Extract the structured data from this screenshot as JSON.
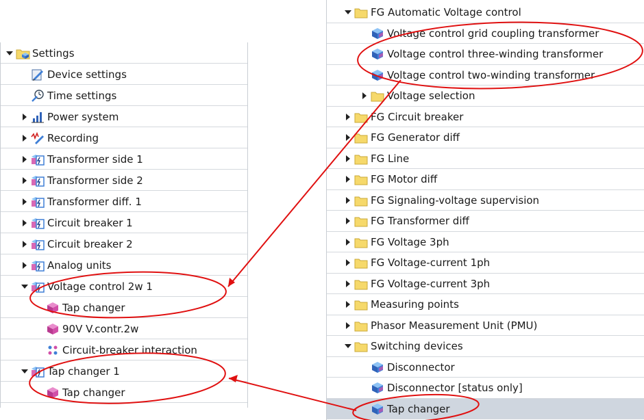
{
  "colors": {
    "annotation": "#e01010",
    "folder": "#f6d96b",
    "cube_blue": "#3f7fd6",
    "cube_pink": "#d14fa8",
    "row_selected": "#cfd6df"
  },
  "left_tree": {
    "items": [
      {
        "label": "Settings",
        "icon": "settings-folder-icon",
        "state": "expanded"
      },
      {
        "label": "Device settings",
        "icon": "device-settings-icon",
        "state": "leaf"
      },
      {
        "label": "Time settings",
        "icon": "time-settings-icon",
        "state": "leaf"
      },
      {
        "label": "Power system",
        "icon": "power-system-icon",
        "state": "collapsed"
      },
      {
        "label": "Recording",
        "icon": "recording-icon",
        "state": "collapsed"
      },
      {
        "label": "Transformer side 1",
        "icon": "function-group-icon",
        "state": "collapsed"
      },
      {
        "label": "Transformer side 2",
        "icon": "function-group-icon",
        "state": "collapsed"
      },
      {
        "label": "Transformer diff. 1",
        "icon": "function-group-icon",
        "state": "collapsed"
      },
      {
        "label": "Circuit breaker 1",
        "icon": "function-group-icon",
        "state": "collapsed"
      },
      {
        "label": "Circuit breaker 2",
        "icon": "function-group-icon",
        "state": "collapsed"
      },
      {
        "label": "Analog units",
        "icon": "function-group-icon",
        "state": "collapsed"
      },
      {
        "label": "Voltage control 2w 1",
        "icon": "function-group-icon",
        "state": "expanded"
      },
      {
        "label": "Tap changer",
        "icon": "pink-cube-icon",
        "state": "leaf"
      },
      {
        "label": "90V V.contr.2w",
        "icon": "pink-cube-icon",
        "state": "leaf"
      },
      {
        "label": "Circuit-breaker interaction",
        "icon": "interaction-icon",
        "state": "leaf"
      },
      {
        "label": "Tap changer 1",
        "icon": "function-group-icon",
        "state": "expanded"
      },
      {
        "label": "Tap changer",
        "icon": "pink-cube-icon",
        "state": "leaf"
      }
    ]
  },
  "right_tree": {
    "items": [
      {
        "label": "FG Automatic Voltage control",
        "icon": "folder-icon",
        "state": "expanded"
      },
      {
        "label": "Voltage control grid coupling transformer",
        "icon": "cube-icon",
        "state": "leaf"
      },
      {
        "label": "Voltage control three-winding transformer",
        "icon": "cube-icon",
        "state": "leaf"
      },
      {
        "label": "Voltage control two-winding transformer",
        "icon": "cube-icon",
        "state": "leaf"
      },
      {
        "label": "Voltage selection",
        "icon": "folder-icon",
        "state": "collapsed"
      },
      {
        "label": "FG Circuit breaker",
        "icon": "folder-icon",
        "state": "collapsed"
      },
      {
        "label": "FG Generator diff",
        "icon": "folder-icon",
        "state": "collapsed"
      },
      {
        "label": "FG Line",
        "icon": "folder-icon",
        "state": "collapsed"
      },
      {
        "label": "FG Motor diff",
        "icon": "folder-icon",
        "state": "collapsed"
      },
      {
        "label": "FG Signaling-voltage supervision",
        "icon": "folder-icon",
        "state": "collapsed"
      },
      {
        "label": "FG Transformer diff",
        "icon": "folder-icon",
        "state": "collapsed"
      },
      {
        "label": "FG Voltage 3ph",
        "icon": "folder-icon",
        "state": "collapsed"
      },
      {
        "label": "FG Voltage-current 1ph",
        "icon": "folder-icon",
        "state": "collapsed"
      },
      {
        "label": "FG Voltage-current 3ph",
        "icon": "folder-icon",
        "state": "collapsed"
      },
      {
        "label": "Measuring points",
        "icon": "folder-icon",
        "state": "collapsed"
      },
      {
        "label": "Phasor Measurement Unit (PMU)",
        "icon": "folder-icon",
        "state": "collapsed"
      },
      {
        "label": "Switching devices",
        "icon": "folder-icon",
        "state": "expanded"
      },
      {
        "label": "Disconnector",
        "icon": "cube-icon",
        "state": "leaf"
      },
      {
        "label": "Disconnector [status only]",
        "icon": "cube-icon",
        "state": "leaf"
      },
      {
        "label": "Tap changer",
        "icon": "cube-icon",
        "state": "leaf",
        "selected": true
      }
    ]
  }
}
